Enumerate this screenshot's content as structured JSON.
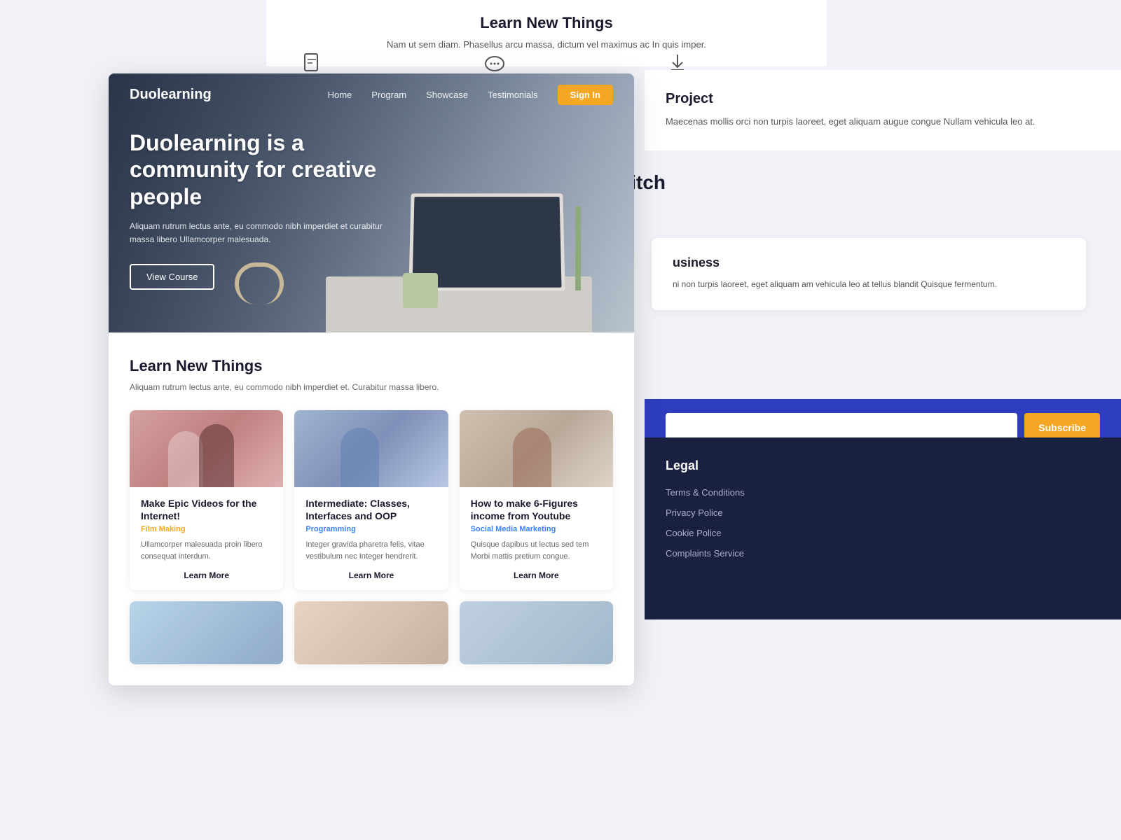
{
  "bg_page": {
    "top_title": "Learn New Things",
    "top_subtitle": "Nam ut sem diam. Phasellus arcu massa, dictum vel maximus ac In quis imper.",
    "icon1_name": "file-icon",
    "icon2_name": "chat-icon",
    "icon3_name": "download-icon",
    "right_section1_title": "Project",
    "right_section1_text": "Maecenas mollis orci non turpis laoreet, eget aliquam augue congue Nullam vehicula leo at.",
    "twitch_partial": "itch",
    "business_title": "usiness",
    "business_text": "ni non turpis laoreet, eget aliquam am vehicula leo at tellus blandit Quisque fermentum.",
    "subscribe_placeholder": "",
    "subscribe_btn": "Subscribe",
    "footer_title": "Legal",
    "footer_links": [
      "Terms & Conditions",
      "Privacy Police",
      "Cookie Police",
      "Complaints Service"
    ]
  },
  "site": {
    "brand": "Duolearning",
    "nav_links": [
      "Home",
      "Program",
      "Showcase",
      "Testimonials"
    ],
    "nav_signin": "Sign In",
    "hero_title": "Duolearning is a community for creative people",
    "hero_subtitle": "Aliquam rutrum lectus ante, eu commodo nibh imperdiet et curabitur massa libero Ullamcorper malesuada.",
    "hero_cta": "View Course",
    "learn_title": "Learn New Things",
    "learn_subtitle": "Aliquam rutrum lectus ante, eu commodo nibh imperdiet et. Curabitur massa libero.",
    "cards": [
      {
        "title": "Make Epic Videos for the Internet!",
        "category": "Film Making",
        "category_class": "cat-film",
        "img_class": "card-img-1",
        "desc": "Ullamcorper malesuada proin libero consequat interdum.",
        "cta": "Learn More"
      },
      {
        "title": "Intermediate: Classes, Interfaces and OOP",
        "category": "Programming",
        "category_class": "cat-prog",
        "img_class": "card-img-2",
        "desc": "Integer gravida pharetra felis, vitae vestibulum nec Integer hendrerit.",
        "cta": "Learn More"
      },
      {
        "title": "How to make 6-Figures income from Youtube",
        "category": "Social Media Marketing",
        "category_class": "cat-social",
        "img_class": "card-img-3",
        "desc": "Quisque dapibus ut lectus sed tem Morbi mattis pretium congue.",
        "cta": "Learn More"
      }
    ],
    "bottom_cards": [
      {
        "img_class": "card-img-4"
      },
      {
        "img_class": "card-img-5"
      },
      {
        "img_class": "card-img-6"
      }
    ]
  }
}
